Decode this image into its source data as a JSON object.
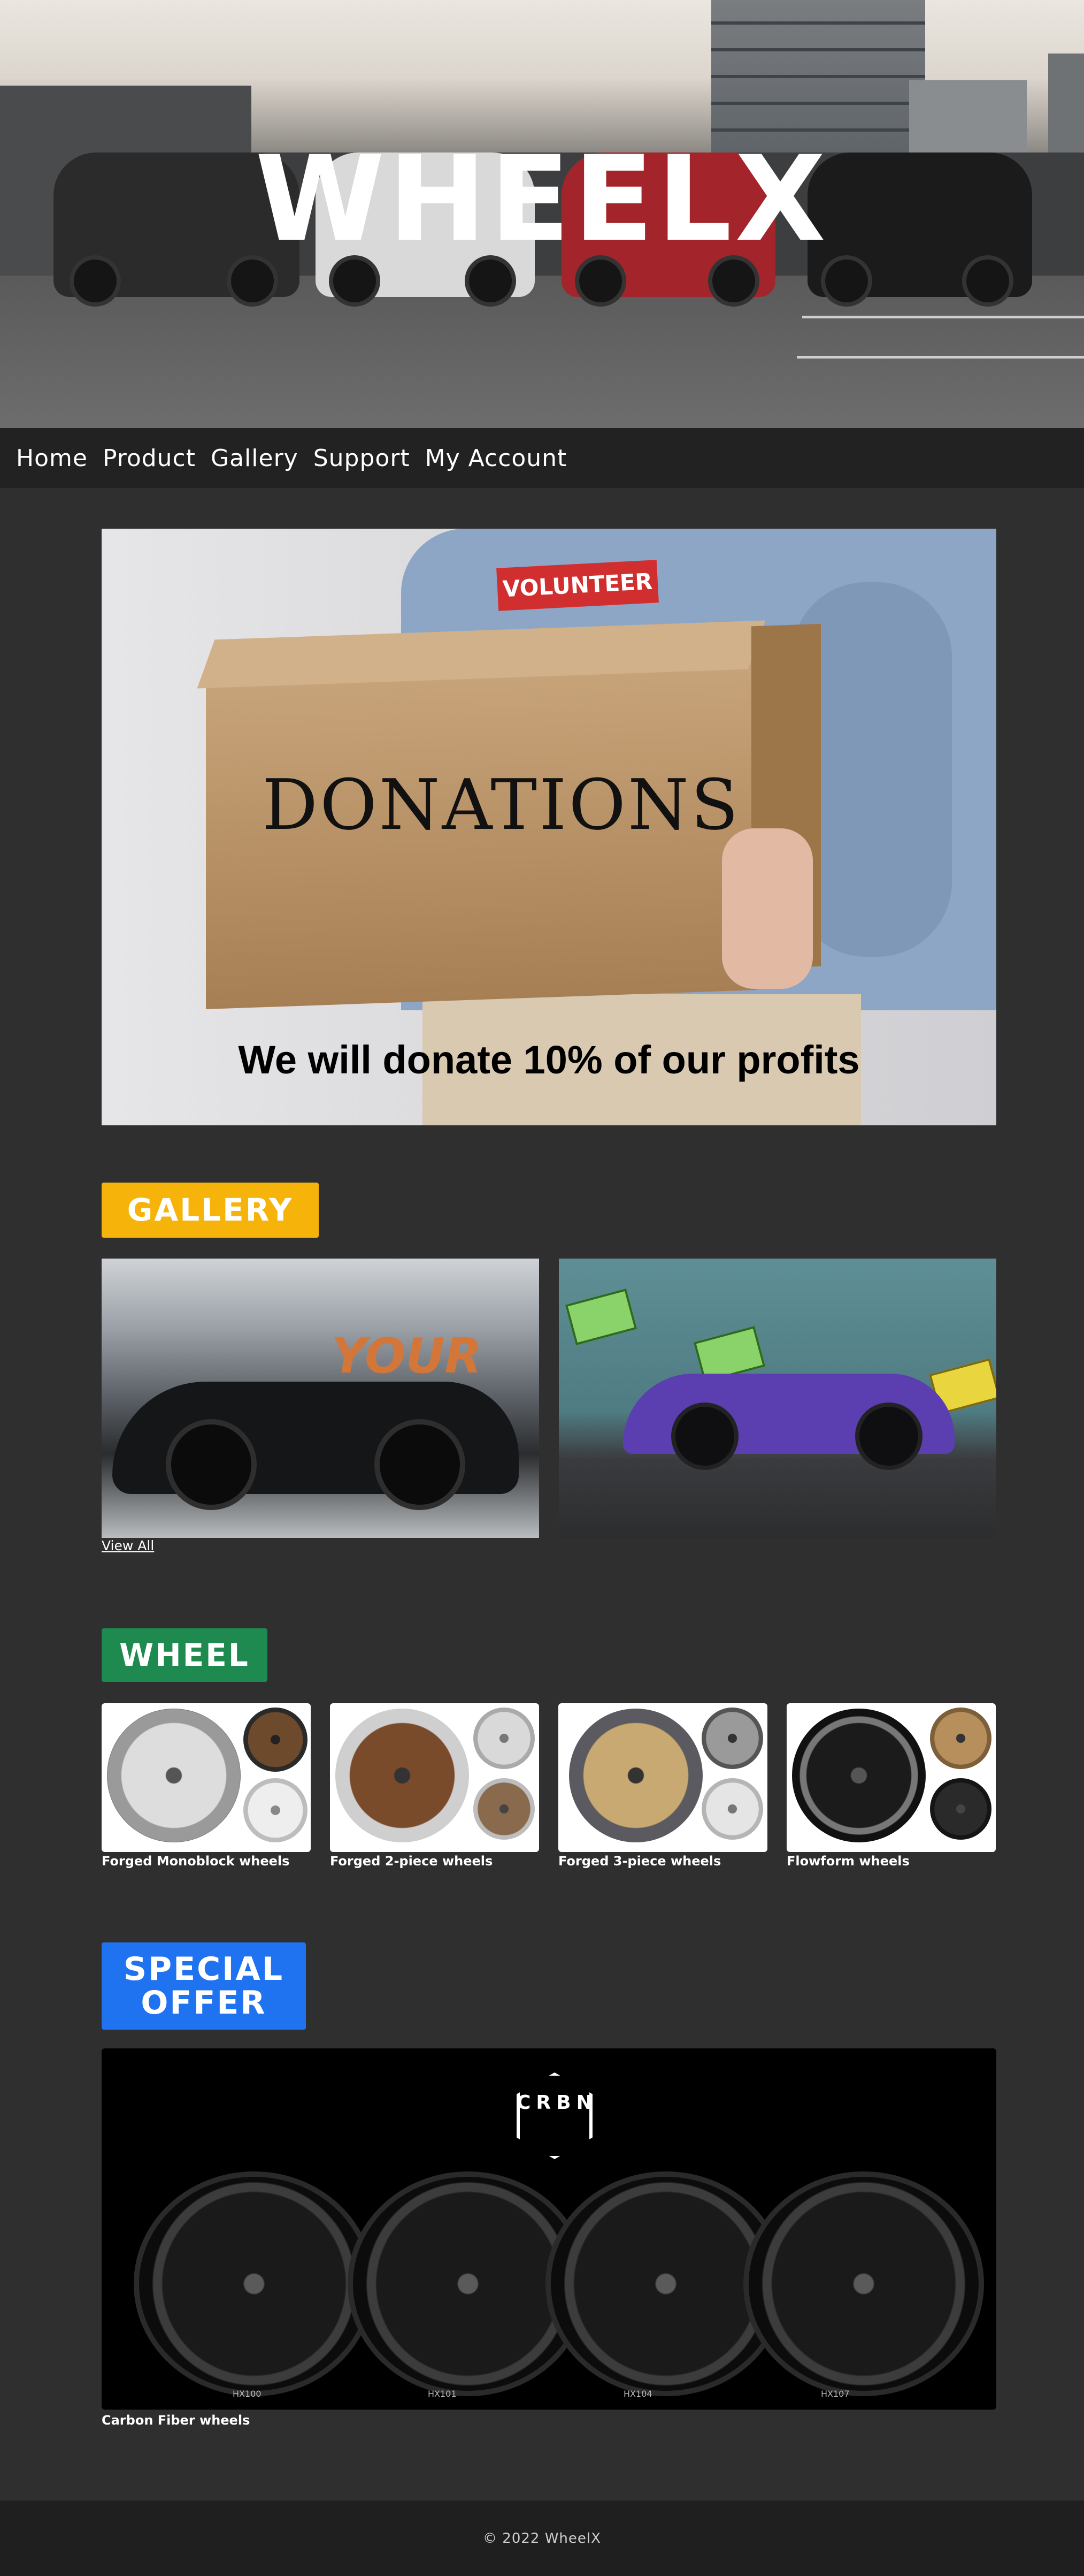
{
  "brand": {
    "logo": "WHEELX"
  },
  "nav": {
    "items": [
      {
        "label": "Home"
      },
      {
        "label": "Product"
      },
      {
        "label": "Gallery"
      },
      {
        "label": "Support"
      },
      {
        "label": "My Account"
      }
    ]
  },
  "donation": {
    "patch": "VOLUNTEER",
    "box_text": "DONATIONS",
    "caption": "We will donate 10% of our profits"
  },
  "gallery": {
    "heading": "GALLERY",
    "mural_text": "YOUR",
    "view_all": "View All"
  },
  "wheel": {
    "heading": "WHEEL",
    "items": [
      {
        "label": "Forged Monoblock wheels"
      },
      {
        "label": "Forged 2-piece wheels"
      },
      {
        "label": "Forged 3-piece wheels"
      },
      {
        "label": "Flowform wheels"
      }
    ]
  },
  "special_offer": {
    "heading": "SPECIAL OFFER",
    "banner_logo": "CRBN",
    "models": [
      "HX100",
      "HX101",
      "HX104",
      "HX107"
    ],
    "label": "Carbon Fiber wheels"
  },
  "footer": {
    "copyright": "© 2022 WheelX"
  },
  "colors": {
    "gallery_badge": "#f6b40b",
    "wheel_badge": "#1e8a4f",
    "special_badge": "#1f72f0",
    "page_bg": "#2f2f2f",
    "nav_bg": "#222222"
  }
}
